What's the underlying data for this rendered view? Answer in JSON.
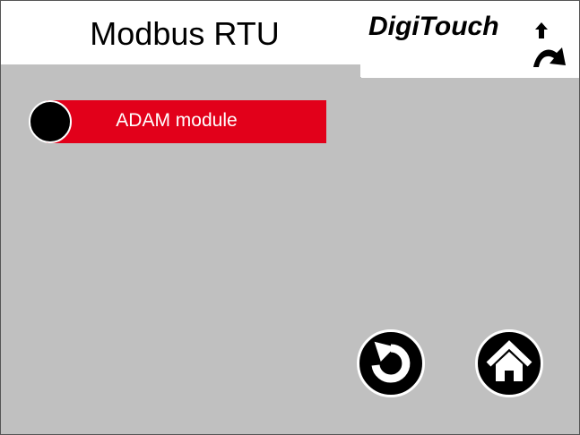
{
  "header": {
    "title": "Modbus RTU",
    "logo_text": "DigiTouch"
  },
  "menu": {
    "items": [
      {
        "label": "ADAM module"
      }
    ]
  },
  "navigation": {
    "back_icon": "back-icon",
    "home_icon": "home-icon"
  },
  "colors": {
    "background": "#c0c0c0",
    "menu_accent": "#e2001a",
    "button": "#000000"
  }
}
